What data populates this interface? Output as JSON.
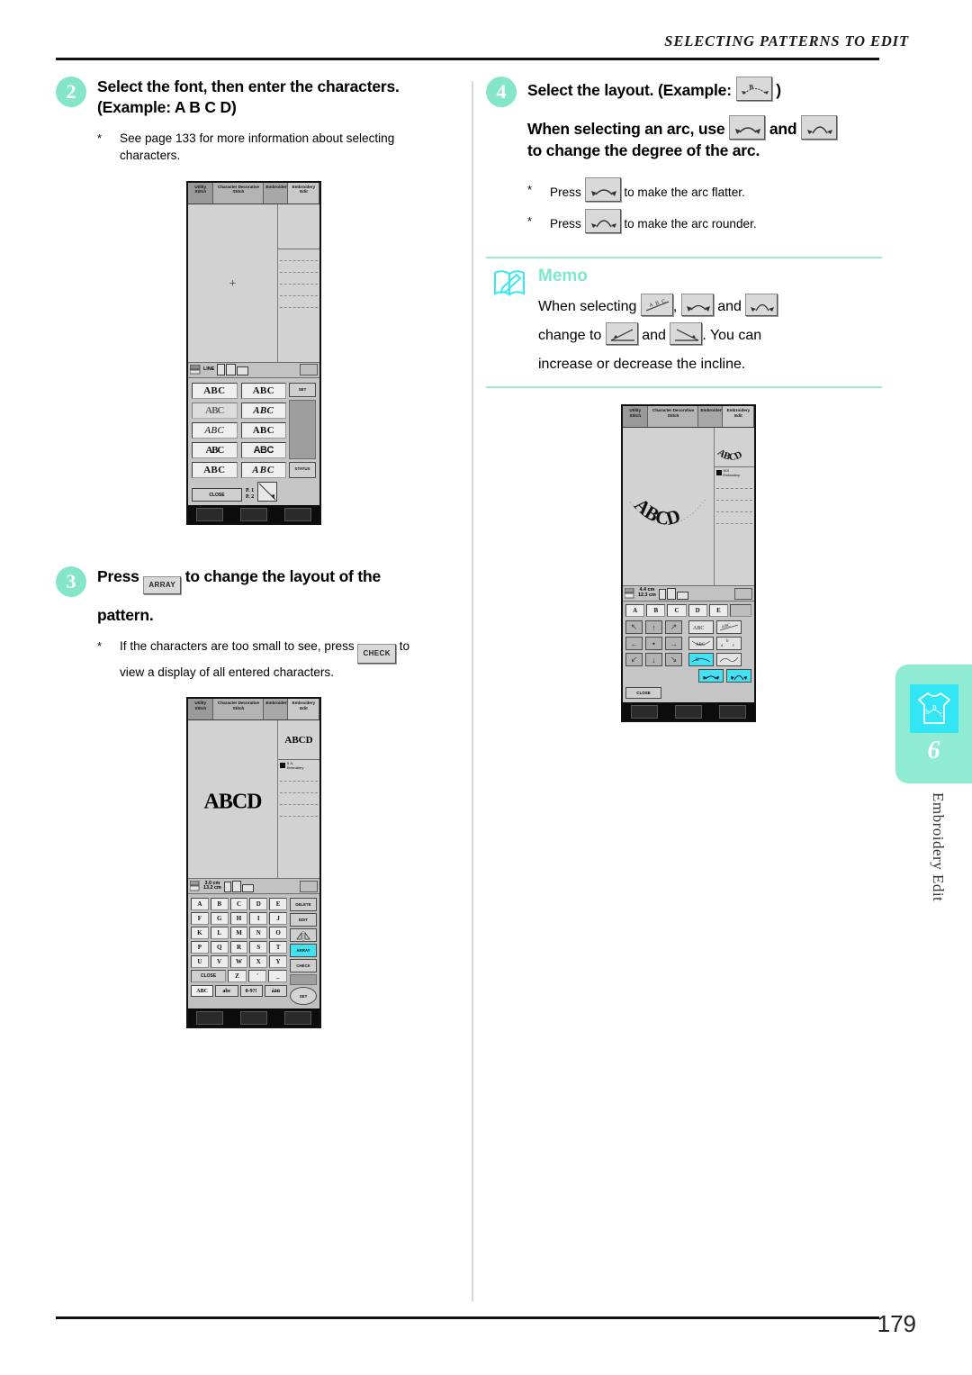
{
  "header": {
    "running_head": "SELECTING PATTERNS TO EDIT"
  },
  "footer": {
    "page_number": "179"
  },
  "colors": {
    "accent_mint": "#85e5c8",
    "accent_cyan": "#33e6f5",
    "lcd_gray": "#c9c9c9",
    "selected_key": "#43e2f0"
  },
  "side_tab": {
    "chapter_number": "6",
    "chapter_title": "Embroidery Edit",
    "icon": "tshirt-arc-icon"
  },
  "left_column": {
    "step2": {
      "number": "2",
      "title": "Select the font, then enter the characters.",
      "title_line2": "(Example: A B C D)",
      "note_star": "*",
      "note": "See page 133 for more information about selecting characters.",
      "screen": {
        "tabs": [
          "Utility Stitch",
          "Character Decorative Stitch",
          "Embroidery",
          "Embroidery Edit"
        ],
        "active_tab": "Embroidery Edit",
        "status_left": "LINE",
        "side_button": "SET",
        "font_grid": [
          [
            "ABC",
            "ABC"
          ],
          [
            "ABC",
            "ABC"
          ],
          [
            "ABC",
            "ABC"
          ],
          [
            "ABC",
            "ABC"
          ],
          [
            "ABC",
            "ABC"
          ]
        ],
        "close_label": "CLOSE",
        "page_indicator_line1": "P. 1",
        "page_indicator_line2": "P. 2",
        "right_button": "STATUS"
      }
    },
    "step3": {
      "number": "3",
      "title_before": "Press",
      "key_label": "ARRAY",
      "title_after": "to change the layout of the",
      "title_line2": "pattern.",
      "note_star": "*",
      "note_before": "If the characters are too small to see, press",
      "note_key": "CHECK",
      "note_after": "to",
      "note_line2": "view a display of all entered characters.",
      "screen": {
        "tabs": [
          "Utility Stitch",
          "Character Decorative Stitch",
          "Embroidery",
          "Embroidery Edit"
        ],
        "preview_text": "ABCD",
        "thumb_text": "ABCD",
        "color_label_1": "5 JL",
        "color_label_2": "Embroidery",
        "size_height": "3.0 cm",
        "size_width": "13.2 cm",
        "keys_row1": [
          "A",
          "B",
          "C",
          "D",
          "E"
        ],
        "keys_row2": [
          "F",
          "G",
          "H",
          "I",
          "J"
        ],
        "keys_row3": [
          "K",
          "L",
          "M",
          "N",
          "O"
        ],
        "keys_row4": [
          "P",
          "Q",
          "R",
          "S",
          "T"
        ],
        "keys_row5": [
          "U",
          "V",
          "W",
          "X",
          "Y"
        ],
        "keys_row6": [
          "CLOSE",
          "Z",
          "'",
          "_"
        ],
        "side_keys": [
          "DELETE",
          "EDIT",
          "MIRROR",
          "ARRAY",
          "CHECK"
        ],
        "side_key_highlighted": "ARRAY",
        "set_key": "SET",
        "modes": [
          "ABC",
          "abc",
          "0-9?!",
          "àäü"
        ],
        "mode_active": "ABC"
      }
    }
  },
  "right_column": {
    "step4": {
      "number": "4",
      "title_before": "Select the layout. (Example:",
      "title_key": "arc-layout-icon",
      "title_after": ")",
      "sub_before": "When selecting an arc, use",
      "sub_key_1": "arc-flatter-icon",
      "sub_and": "and",
      "sub_key_2": "arc-rounder-icon",
      "sub_line2": "to change the degree of the arc.",
      "bullets": [
        {
          "star": "*",
          "before": "Press",
          "key": "arc-flatter-icon",
          "after": "to make the arc flatter."
        },
        {
          "star": "*",
          "before": "Press",
          "key": "arc-rounder-icon",
          "after": "to make the arc rounder."
        }
      ]
    },
    "memo": {
      "title": "Memo",
      "icon": "memo-book-pencil-icon",
      "line1_a": "When selecting",
      "line1_key1": "incline-abc-icon",
      "line1_comma": ",",
      "line1_key2": "arc-flatter-icon",
      "line1_and": "and",
      "line1_key3": "arc-rounder-icon",
      "line2_a": "change to",
      "line2_key1": "incline-up-icon",
      "line2_and": "and",
      "line2_key2": "incline-down-icon",
      "line2_b": ". You can",
      "line3": "increase or decrease the incline."
    },
    "screen": {
      "tabs": [
        "Utility Stitch",
        "Character Decorative Stitch",
        "Embroidery",
        "Embroidery Edit"
      ],
      "arc_text": "ABCD",
      "thumb_text": "ABCD",
      "color_label_1": "9C0",
      "color_label_2": "Embroidery",
      "size_height": "4.4 cm",
      "size_width": "12.3 cm",
      "keys_row1": [
        "A",
        "B",
        "C",
        "D",
        "E"
      ],
      "layout_buttons": [
        "straight",
        "incline-abc",
        "arc-down",
        "fan",
        "arc-up-selected",
        "wave",
        "arc-flatter",
        "arc-rounder"
      ],
      "selected_layout": "arc-up-selected",
      "close_label": "CLOSE"
    }
  }
}
